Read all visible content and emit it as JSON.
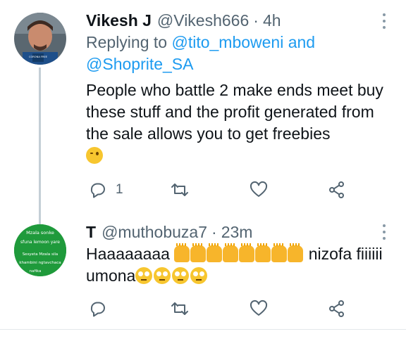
{
  "tweets": [
    {
      "name": "Vikesh J",
      "handle": "@Vikesh666",
      "separator": "·",
      "time": "4h",
      "reply_prefix": "Replying to",
      "reply_mentions": "@tito_mboweni and @Shoprite_SA",
      "text": "People who battle 2 make ends meet buy these stuff and the profit generated from the sale allows you to get freebies",
      "avatar_label": "CORONA FREE",
      "reply_count": "1"
    },
    {
      "name": "T",
      "handle": "@muthobuza7",
      "separator": "·",
      "time": "23m",
      "text_start": "Haaaaaaaa",
      "text_mid": "nizofa fiiiiii umona",
      "avatar_lines": [
        "Mzala sonke",
        "sfuna lemoon yare",
        "Sesyeta Mzala sila",
        "khambini ngtavchaca",
        "nafika"
      ]
    }
  ],
  "icons": {
    "reply": "reply-icon",
    "retweet": "retweet-icon",
    "like": "heart-icon",
    "share": "share-icon",
    "more": "more-options-icon"
  },
  "colors": {
    "accent": "#1d9bf0",
    "secondary": "#536471",
    "thread_line": "#c4cfd6"
  }
}
